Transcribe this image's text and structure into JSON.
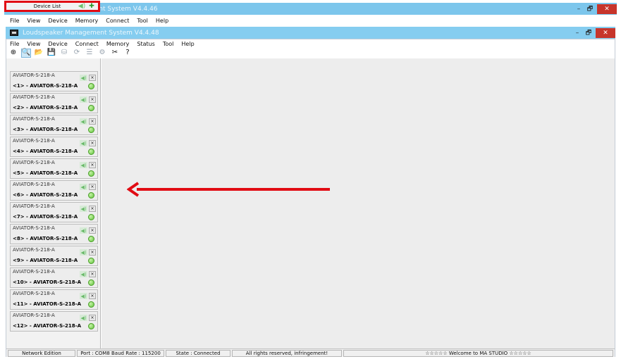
{
  "outer_window": {
    "title": "Loudspeaker Management System V4.4.46",
    "menu": [
      "File",
      "View",
      "Device",
      "Memory",
      "Connect",
      "Tool",
      "Help"
    ]
  },
  "inner_window": {
    "title": "Loudspeaker Management System V4.4.48",
    "menu": [
      "File",
      "View",
      "Device",
      "Connect",
      "Memory",
      "Status",
      "Tool",
      "Help"
    ]
  },
  "window_controls": {
    "minimize": "–",
    "restore": "🗗",
    "close": "✕"
  },
  "toolbar": [
    {
      "icon": "add-device-icon",
      "glyph": "⊕",
      "state": "normal"
    },
    {
      "icon": "search-icon",
      "glyph": "🔍",
      "state": "selected"
    },
    {
      "icon": "open-folder-icon",
      "glyph": "📂",
      "state": "disabled"
    },
    {
      "icon": "save-icon",
      "glyph": "💾",
      "state": "disabled"
    },
    {
      "icon": "database-icon",
      "glyph": "⛁",
      "state": "disabled"
    },
    {
      "icon": "refresh-icon",
      "glyph": "⟳",
      "state": "disabled"
    },
    {
      "icon": "list-icon",
      "glyph": "☰",
      "state": "disabled"
    },
    {
      "icon": "settings-icon",
      "glyph": "⚙",
      "state": "disabled"
    },
    {
      "icon": "tools-icon",
      "glyph": "✂",
      "state": "normal"
    },
    {
      "icon": "help-icon",
      "glyph": "?",
      "state": "normal"
    }
  ],
  "device_list": {
    "title": "Device List",
    "devices": [
      {
        "model": "AVIATOR-S-218-A",
        "name": "<1> - AVIATOR-S-218-A"
      },
      {
        "model": "AVIATOR-S-218-A",
        "name": "<2> - AVIATOR-S-218-A"
      },
      {
        "model": "AVIATOR-S-218-A",
        "name": "<3> - AVIATOR-S-218-A"
      },
      {
        "model": "AVIATOR-S-218-A",
        "name": "<4> - AVIATOR-S-218-A"
      },
      {
        "model": "AVIATOR-S-218-A",
        "name": "<5> - AVIATOR-S-218-A"
      },
      {
        "model": "AVIATOR-S-218-A",
        "name": "<6> - AVIATOR-S-218-A"
      },
      {
        "model": "AVIATOR-S-218-A",
        "name": "<7> - AVIATOR-S-218-A"
      },
      {
        "model": "AVIATOR-S-218-A",
        "name": "<8> - AVIATOR-S-218-A"
      },
      {
        "model": "AVIATOR-S-218-A",
        "name": "<9> - AVIATOR-S-218-A"
      },
      {
        "model": "AVIATOR-S-218-A",
        "name": "<10> - AVIATOR-S-218-A"
      },
      {
        "model": "AVIATOR-S-218-A",
        "name": "<11> - AVIATOR-S-218-A"
      },
      {
        "model": "AVIATOR-S-218-A",
        "name": "<12> - AVIATOR-S-218-A"
      }
    ]
  },
  "statusbar": {
    "edition": "Network Edition",
    "port": "Port : COM8  Baud Rate : 115200",
    "state": "State : Connected",
    "rights": "All rights reserved, infringement!",
    "welcome": "☆☆☆☆☆ Welcome to MA STUDIO ☆☆☆☆☆"
  },
  "colors": {
    "highlight_red": "#e10c14",
    "titlebar_blue": "#7cc6ec",
    "close_red": "#c7352b",
    "status_green": "#5fc23a"
  }
}
